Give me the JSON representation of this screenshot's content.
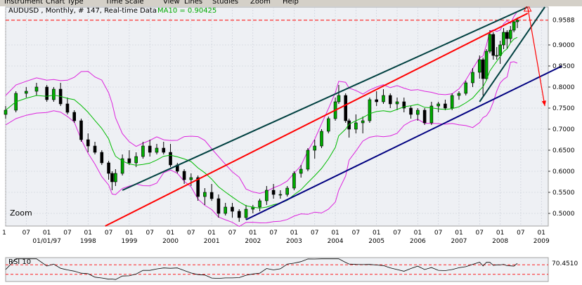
{
  "menu": [
    "Instrument",
    "Chart Type",
    "Time Scale",
    "View",
    "Lines",
    "Studies",
    "Zoom",
    "Help"
  ],
  "header": {
    "symbol_info": "AUDUSD , Monthly, # 147, Real-time Data",
    "ma_label": "MA10 = 0.90425"
  },
  "zoom_label": "Zoom",
  "colors": {
    "background": "#ffffff",
    "panel_bg": "#eef0f4",
    "up_candle": "#00aa00",
    "down_candle": "#000000",
    "ma": "#00bb00",
    "bollinger": "#dd22dd",
    "trend_red": "#ff0000",
    "trend_green": "#004040",
    "trend_blue": "#000080",
    "last_price_line": "#ff0000"
  },
  "chart_data": {
    "type": "candlestick",
    "title": "AUDUSD , Monthly, # 147, Real-time Data",
    "y_ticks": [
      0.5,
      0.55,
      0.6,
      0.65,
      0.7,
      0.75,
      0.8,
      0.85,
      0.9
    ],
    "y_tick_labels": [
      "0.5000",
      "0.5500",
      "0.6000",
      "0.6500",
      "0.7000",
      "0.7500",
      "0.8000",
      "0.8500",
      "0.9000"
    ],
    "last_price": 0.9588,
    "last_price_label": "0.9588",
    "ylim": [
      0.47,
      0.99
    ],
    "x_month_labels": [
      "1",
      "07",
      "01",
      "07",
      "01",
      "07",
      "01",
      "07",
      "01",
      "07",
      "01",
      "07",
      "01",
      "07",
      "01",
      "07",
      "01",
      "07",
      "01",
      "07",
      "01",
      "07",
      "01",
      "07",
      "01",
      "07",
      "01",
      "07",
      "01"
    ],
    "x_year_labels": [
      "01/01/97",
      "1998",
      "1999",
      "2000",
      "2001",
      "2002",
      "2003",
      "2004",
      "2005",
      "2006",
      "2007",
      "2008",
      "2009"
    ],
    "x_range": [
      "1996-01",
      "2009-03"
    ],
    "grid": true,
    "trend_lines": [
      {
        "color": "red",
        "from": [
          "1998-06",
          0.47
        ],
        "to": [
          "2008-09",
          0.975
        ]
      },
      {
        "color": "green",
        "from": [
          "1998-11",
          0.555
        ],
        "to": [
          "2008-09",
          0.99
        ]
      },
      {
        "color": "green",
        "from": [
          "2007-07",
          0.765
        ],
        "to": [
          "2009-02",
          0.99
        ]
      },
      {
        "color": "blue",
        "from": [
          "2001-11",
          0.485
        ],
        "to": [
          "2009-07",
          0.85
        ]
      }
    ],
    "arrow": {
      "from": [
        "2008-09",
        0.99
      ],
      "to": [
        "2009-02",
        0.755
      ]
    },
    "rsi": {
      "label": "RSI 10",
      "value_label": "70.4510",
      "levels": [
        70,
        30
      ],
      "ylim": [
        0,
        100
      ]
    },
    "series": [
      {
        "date": "1996-01",
        "open": 0.735,
        "high": 0.755,
        "low": 0.725,
        "close": 0.745
      },
      {
        "date": "1996-04",
        "open": 0.745,
        "high": 0.79,
        "low": 0.74,
        "close": 0.785
      },
      {
        "date": "1996-07",
        "open": 0.785,
        "high": 0.8,
        "low": 0.775,
        "close": 0.79
      },
      {
        "date": "1996-10",
        "open": 0.79,
        "high": 0.81,
        "low": 0.78,
        "close": 0.8
      },
      {
        "date": "1997-01",
        "open": 0.8,
        "high": 0.805,
        "low": 0.765,
        "close": 0.77
      },
      {
        "date": "1997-03",
        "open": 0.77,
        "high": 0.8,
        "low": 0.765,
        "close": 0.795
      },
      {
        "date": "1997-05",
        "open": 0.795,
        "high": 0.81,
        "low": 0.755,
        "close": 0.76
      },
      {
        "date": "1997-07",
        "open": 0.76,
        "high": 0.775,
        "low": 0.735,
        "close": 0.74
      },
      {
        "date": "1997-09",
        "open": 0.74,
        "high": 0.745,
        "low": 0.715,
        "close": 0.72
      },
      {
        "date": "1997-11",
        "open": 0.72,
        "high": 0.725,
        "low": 0.67,
        "close": 0.675
      },
      {
        "date": "1998-01",
        "open": 0.675,
        "high": 0.69,
        "low": 0.645,
        "close": 0.66
      },
      {
        "date": "1998-03",
        "open": 0.66,
        "high": 0.67,
        "low": 0.64,
        "close": 0.645
      },
      {
        "date": "1998-05",
        "open": 0.645,
        "high": 0.65,
        "low": 0.615,
        "close": 0.62
      },
      {
        "date": "1998-07",
        "open": 0.62,
        "high": 0.625,
        "low": 0.58,
        "close": 0.595
      },
      {
        "date": "1998-08",
        "open": 0.595,
        "high": 0.6,
        "low": 0.555,
        "close": 0.575
      },
      {
        "date": "1998-09",
        "open": 0.575,
        "high": 0.605,
        "low": 0.565,
        "close": 0.595
      },
      {
        "date": "1998-11",
        "open": 0.595,
        "high": 0.64,
        "low": 0.59,
        "close": 0.63
      },
      {
        "date": "1999-01",
        "open": 0.63,
        "high": 0.65,
        "low": 0.615,
        "close": 0.62
      },
      {
        "date": "1999-03",
        "open": 0.62,
        "high": 0.645,
        "low": 0.61,
        "close": 0.635
      },
      {
        "date": "1999-05",
        "open": 0.635,
        "high": 0.67,
        "low": 0.63,
        "close": 0.66
      },
      {
        "date": "1999-07",
        "open": 0.66,
        "high": 0.675,
        "low": 0.635,
        "close": 0.645
      },
      {
        "date": "1999-09",
        "open": 0.645,
        "high": 0.665,
        "low": 0.64,
        "close": 0.655
      },
      {
        "date": "1999-11",
        "open": 0.655,
        "high": 0.67,
        "low": 0.64,
        "close": 0.645
      },
      {
        "date": "2000-01",
        "open": 0.645,
        "high": 0.665,
        "low": 0.61,
        "close": 0.615
      },
      {
        "date": "2000-03",
        "open": 0.615,
        "high": 0.62,
        "low": 0.595,
        "close": 0.6
      },
      {
        "date": "2000-05",
        "open": 0.6,
        "high": 0.605,
        "low": 0.57,
        "close": 0.58
      },
      {
        "date": "2000-07",
        "open": 0.58,
        "high": 0.595,
        "low": 0.565,
        "close": 0.585
      },
      {
        "date": "2000-09",
        "open": 0.585,
        "high": 0.59,
        "low": 0.53,
        "close": 0.54
      },
      {
        "date": "2000-11",
        "open": 0.54,
        "high": 0.56,
        "low": 0.52,
        "close": 0.55
      },
      {
        "date": "2001-01",
        "open": 0.55,
        "high": 0.57,
        "low": 0.53,
        "close": 0.535
      },
      {
        "date": "2001-03",
        "open": 0.535,
        "high": 0.545,
        "low": 0.49,
        "close": 0.5
      },
      {
        "date": "2001-05",
        "open": 0.5,
        "high": 0.525,
        "low": 0.495,
        "close": 0.515
      },
      {
        "date": "2001-07",
        "open": 0.515,
        "high": 0.525,
        "low": 0.49,
        "close": 0.505
      },
      {
        "date": "2001-09",
        "open": 0.505,
        "high": 0.51,
        "low": 0.48,
        "close": 0.49
      },
      {
        "date": "2001-11",
        "open": 0.49,
        "high": 0.52,
        "low": 0.485,
        "close": 0.51
      },
      {
        "date": "2002-01",
        "open": 0.51,
        "high": 0.52,
        "low": 0.5,
        "close": 0.515
      },
      {
        "date": "2002-03",
        "open": 0.515,
        "high": 0.535,
        "low": 0.505,
        "close": 0.53
      },
      {
        "date": "2002-05",
        "open": 0.53,
        "high": 0.565,
        "low": 0.52,
        "close": 0.555
      },
      {
        "date": "2002-07",
        "open": 0.555,
        "high": 0.57,
        "low": 0.535,
        "close": 0.545
      },
      {
        "date": "2002-09",
        "open": 0.545,
        "high": 0.555,
        "low": 0.535,
        "close": 0.545
      },
      {
        "date": "2002-11",
        "open": 0.545,
        "high": 0.565,
        "low": 0.54,
        "close": 0.56
      },
      {
        "date": "2003-01",
        "open": 0.56,
        "high": 0.6,
        "low": 0.555,
        "close": 0.595
      },
      {
        "date": "2003-03",
        "open": 0.595,
        "high": 0.615,
        "low": 0.585,
        "close": 0.605
      },
      {
        "date": "2003-05",
        "open": 0.605,
        "high": 0.655,
        "low": 0.6,
        "close": 0.65
      },
      {
        "date": "2003-07",
        "open": 0.65,
        "high": 0.675,
        "low": 0.63,
        "close": 0.66
      },
      {
        "date": "2003-09",
        "open": 0.66,
        "high": 0.7,
        "low": 0.655,
        "close": 0.695
      },
      {
        "date": "2003-11",
        "open": 0.695,
        "high": 0.73,
        "low": 0.69,
        "close": 0.725
      },
      {
        "date": "2004-01",
        "open": 0.725,
        "high": 0.775,
        "low": 0.72,
        "close": 0.765
      },
      {
        "date": "2004-02",
        "open": 0.765,
        "high": 0.805,
        "low": 0.76,
        "close": 0.78
      },
      {
        "date": "2004-04",
        "open": 0.78,
        "high": 0.785,
        "low": 0.715,
        "close": 0.72
      },
      {
        "date": "2004-05",
        "open": 0.72,
        "high": 0.725,
        "low": 0.68,
        "close": 0.7
      },
      {
        "date": "2004-07",
        "open": 0.7,
        "high": 0.735,
        "low": 0.69,
        "close": 0.715
      },
      {
        "date": "2004-09",
        "open": 0.715,
        "high": 0.73,
        "low": 0.69,
        "close": 0.72
      },
      {
        "date": "2004-11",
        "open": 0.72,
        "high": 0.775,
        "low": 0.715,
        "close": 0.77
      },
      {
        "date": "2005-01",
        "open": 0.77,
        "high": 0.79,
        "low": 0.755,
        "close": 0.765
      },
      {
        "date": "2005-03",
        "open": 0.765,
        "high": 0.795,
        "low": 0.76,
        "close": 0.78
      },
      {
        "date": "2005-05",
        "open": 0.78,
        "high": 0.785,
        "low": 0.75,
        "close": 0.76
      },
      {
        "date": "2005-07",
        "open": 0.76,
        "high": 0.775,
        "low": 0.745,
        "close": 0.765
      },
      {
        "date": "2005-09",
        "open": 0.765,
        "high": 0.775,
        "low": 0.74,
        "close": 0.75
      },
      {
        "date": "2005-11",
        "open": 0.75,
        "high": 0.755,
        "low": 0.725,
        "close": 0.735
      },
      {
        "date": "2006-01",
        "open": 0.735,
        "high": 0.75,
        "low": 0.72,
        "close": 0.745
      },
      {
        "date": "2006-03",
        "open": 0.745,
        "high": 0.75,
        "low": 0.71,
        "close": 0.715
      },
      {
        "date": "2006-05",
        "open": 0.715,
        "high": 0.765,
        "low": 0.71,
        "close": 0.755
      },
      {
        "date": "2006-07",
        "open": 0.755,
        "high": 0.765,
        "low": 0.74,
        "close": 0.76
      },
      {
        "date": "2006-09",
        "open": 0.76,
        "high": 0.77,
        "low": 0.745,
        "close": 0.75
      },
      {
        "date": "2006-11",
        "open": 0.75,
        "high": 0.785,
        "low": 0.745,
        "close": 0.78
      },
      {
        "date": "2007-01",
        "open": 0.78,
        "high": 0.79,
        "low": 0.77,
        "close": 0.785
      },
      {
        "date": "2007-03",
        "open": 0.785,
        "high": 0.815,
        "low": 0.78,
        "close": 0.81
      },
      {
        "date": "2007-05",
        "open": 0.81,
        "high": 0.845,
        "low": 0.8,
        "close": 0.835
      },
      {
        "date": "2007-07",
        "open": 0.835,
        "high": 0.875,
        "low": 0.82,
        "close": 0.865
      },
      {
        "date": "2007-08",
        "open": 0.865,
        "high": 0.87,
        "low": 0.78,
        "close": 0.82
      },
      {
        "date": "2007-09",
        "open": 0.82,
        "high": 0.89,
        "low": 0.815,
        "close": 0.885
      },
      {
        "date": "2007-10",
        "open": 0.885,
        "high": 0.935,
        "low": 0.88,
        "close": 0.925
      },
      {
        "date": "2007-11",
        "open": 0.925,
        "high": 0.93,
        "low": 0.865,
        "close": 0.875
      },
      {
        "date": "2007-12",
        "open": 0.875,
        "high": 0.895,
        "low": 0.865,
        "close": 0.875
      },
      {
        "date": "2008-01",
        "open": 0.875,
        "high": 0.91,
        "low": 0.855,
        "close": 0.9
      },
      {
        "date": "2008-02",
        "open": 0.9,
        "high": 0.94,
        "low": 0.89,
        "close": 0.93
      },
      {
        "date": "2008-03",
        "open": 0.93,
        "high": 0.935,
        "low": 0.89,
        "close": 0.915
      },
      {
        "date": "2008-04",
        "open": 0.915,
        "high": 0.945,
        "low": 0.905,
        "close": 0.935
      },
      {
        "date": "2008-05",
        "open": 0.935,
        "high": 0.96,
        "low": 0.93,
        "close": 0.955
      },
      {
        "date": "2008-06",
        "open": 0.955,
        "high": 0.965,
        "low": 0.94,
        "close": 0.9588
      }
    ]
  }
}
